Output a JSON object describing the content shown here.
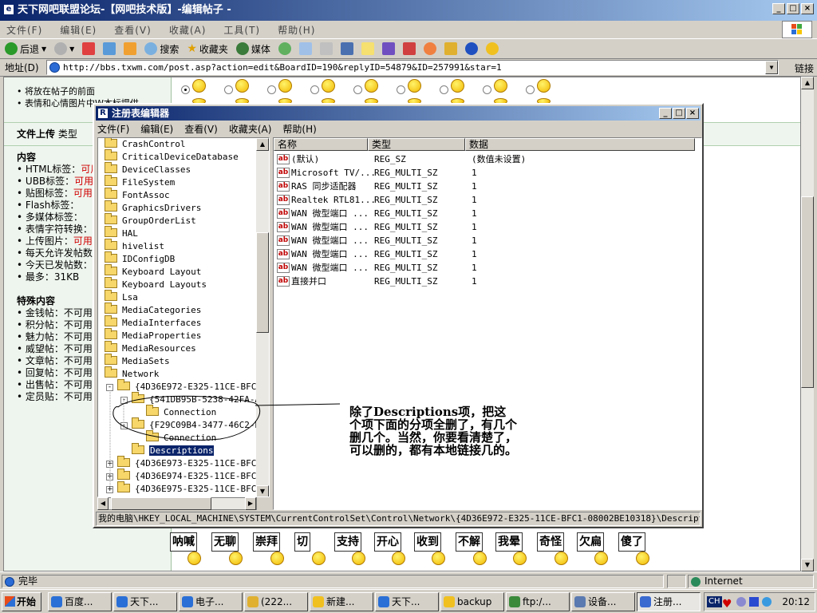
{
  "browser": {
    "title": "天下网吧联盟论坛-【网吧技术版】-编辑帖子 -",
    "menu": [
      "文件(F)",
      "编辑(E)",
      "查看(V)",
      "收藏(A)",
      "工具(T)",
      "帮助(H)"
    ],
    "toolbar": {
      "back": "后退",
      "search": "搜索",
      "favorites": "收藏夹",
      "media": "媒体"
    },
    "address_label": "地址(D)",
    "address_value": "http://bbs.txwm.com/post.asp?action=edit&BoardID=190&replyID=54879&ID=257991&star=1",
    "links_label": "链接"
  },
  "forum": {
    "top_items": [
      "将放在帖子的前面",
      "表情和心情图片中W本标提供"
    ],
    "upload_label": "文件上传",
    "upload_type": "类型",
    "content_heading": "内容",
    "content_items": [
      {
        "label": "HTML标签：",
        "value": "可用"
      },
      {
        "label": "UBB标签：",
        "value": "可用"
      },
      {
        "label": "贴图标签：",
        "value": "可用"
      },
      {
        "label": "Flash标签：",
        "value": ""
      },
      {
        "label": "多媒体标签：",
        "value": ""
      },
      {
        "label": "表情字符转换：",
        "value": ""
      },
      {
        "label": "上传图片：",
        "value": "可用"
      },
      {
        "label": "每天允许发帖数",
        "value": ""
      },
      {
        "label": "今天已发帖数：",
        "value": ""
      },
      {
        "label": "最多：31KB",
        "value": ""
      }
    ],
    "special_heading": "特殊内容",
    "special_items": [
      "金钱帖：不可用",
      "积分帖：不可用",
      "魅力帖：不可用",
      "威望帖：不可用",
      "文章帖：不可用",
      "回复帖：不可用",
      "出售帖：不可用",
      "定员贴：不可用"
    ],
    "emoticon_labels": [
      "呐喊",
      "无聊",
      "崇拜",
      "切",
      "支持",
      "开心",
      "收到",
      "不解",
      "我晕",
      "奇怪",
      "欠扁",
      "傻了"
    ]
  },
  "regedit": {
    "title": "注册表编辑器",
    "menu": [
      "文件(F)",
      "编辑(E)",
      "查看(V)",
      "收藏夹(A)",
      "帮助(H)"
    ],
    "tree": [
      "CrashControl",
      "CriticalDeviceDatabase",
      "DeviceClasses",
      "FileSystem",
      "FontAssoc",
      "GraphicsDrivers",
      "GroupOrderList",
      "HAL",
      "hivelist",
      "IDConfigDB",
      "Keyboard Layout",
      "Keyboard Layouts",
      "Lsa",
      "MediaCategories",
      "MediaInterfaces",
      "MediaProperties",
      "MediaResources",
      "MediaSets",
      "Network"
    ],
    "network_children": [
      {
        "label": "{4D36E972-E325-11CE-BFC1-",
        "expand": "-"
      },
      {
        "label": "{541DB95B-5238-42FA-AE",
        "expand": "-"
      },
      {
        "label": "Connection",
        "expand": ""
      },
      {
        "label": "{F29C09B4-3477-46C2-B4",
        "expand": "-"
      },
      {
        "label": "Connection",
        "expand": ""
      },
      {
        "label": "Descriptions",
        "expand": ""
      },
      {
        "label": "{4D36E973-E325-11CE-BFC1-",
        "expand": "+"
      },
      {
        "label": "{4D36E974-E325-11CE-BFC1-",
        "expand": "+"
      },
      {
        "label": "{4D36E975-E325-11CE-BFC1-",
        "expand": "+"
      }
    ],
    "columns": [
      "名称",
      "类型",
      "数据"
    ],
    "values": [
      {
        "name": "(默认)",
        "type": "REG_SZ",
        "data": "(数值未设置)"
      },
      {
        "name": "Microsoft TV/...",
        "type": "REG_MULTI_SZ",
        "data": "1"
      },
      {
        "name": "RAS 同步适配器",
        "type": "REG_MULTI_SZ",
        "data": "1"
      },
      {
        "name": "Realtek RTL81...",
        "type": "REG_MULTI_SZ",
        "data": "1"
      },
      {
        "name": "WAN 微型端口 ...",
        "type": "REG_MULTI_SZ",
        "data": "1"
      },
      {
        "name": "WAN 微型端口 ...",
        "type": "REG_MULTI_SZ",
        "data": "1"
      },
      {
        "name": "WAN 微型端口 ...",
        "type": "REG_MULTI_SZ",
        "data": "1"
      },
      {
        "name": "WAN 微型端口 ...",
        "type": "REG_MULTI_SZ",
        "data": "1"
      },
      {
        "name": "WAN 微型端口 ...",
        "type": "REG_MULTI_SZ",
        "data": "1"
      },
      {
        "name": "直接并口",
        "type": "REG_MULTI_SZ",
        "data": "1"
      }
    ],
    "status_path": "我的电脑\\HKEY_LOCAL_MACHINE\\SYSTEM\\CurrentControlSet\\Control\\Network\\{4D36E972-E325-11CE-BFC1-08002BE10318}\\Descriptions"
  },
  "annotation": "除了Descriptions项，把这个项下面的分项全删了，有几个删几个。当然，你要看清楚了，可以删的，都有本地链接几的。",
  "statusbar": {
    "left": "完毕",
    "zone": "Internet"
  },
  "taskbar": {
    "start": "开始",
    "buttons": [
      "百度...",
      "天下...",
      "电子...",
      "(222...",
      "新建...",
      "天下...",
      "backup",
      "ftp:/...",
      "设备...",
      "注册..."
    ],
    "clock": "20:12",
    "ime": "CH"
  }
}
